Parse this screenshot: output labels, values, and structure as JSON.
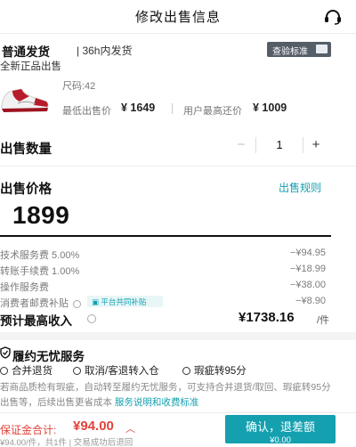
{
  "header": {
    "title": "修改出售信息",
    "headset_icon": "headset-icon"
  },
  "shipping": {
    "title": "普通发货",
    "subtitle": "| 36h内发货",
    "check_tag": "查验标准",
    "condition": "全新正品出售"
  },
  "product": {
    "size": "尺码:42",
    "lowest_label": "最低出售价",
    "lowest_price": "¥ 1649",
    "highest_label": "用户最高还价",
    "highest_price": "¥ 1009"
  },
  "quantity": {
    "label": "出售数量",
    "minus": "−",
    "value": "1",
    "plus": "+"
  },
  "price": {
    "label": "出售价格",
    "rules_link": "出售规则",
    "value": "1899"
  },
  "fees": [
    {
      "name": "技术服务费 5.00%",
      "amount": "−¥94.95"
    },
    {
      "name": "转账手续费 1.00%",
      "amount": "−¥18.99"
    },
    {
      "name": "操作服务费",
      "amount": "−¥38.00"
    },
    {
      "name": "消费者邮费补贴",
      "amount": "−¥8.90",
      "badge": "平台共同补贴"
    }
  ],
  "income": {
    "label": "预计最高收入",
    "value": "¥1738.16",
    "unit": "/件"
  },
  "service": {
    "title": "履约无忧服务",
    "items": [
      "合并退货",
      "取消/客退转入仓",
      "瑕疵转95分"
    ],
    "description": "若商品质检有瑕疵，自动转至履约无忧服务，可支持合并退货/取回、瑕疵转95分出售等，后续出售更省成本",
    "link": "服务说明和收费标准"
  },
  "footer": {
    "deposit_label": "保证金合计:",
    "deposit_value": "¥94.00",
    "deposit_chevron": "︿",
    "deposit_sub": "¥94.00/件，共1件 | 交易成功后退回",
    "confirm_label": "确认，退差额",
    "confirm_sub": "¥0.00"
  },
  "colors": {
    "accent": "#15a0b0",
    "alert": "#e0433a",
    "tag_bg": "#555d67"
  }
}
